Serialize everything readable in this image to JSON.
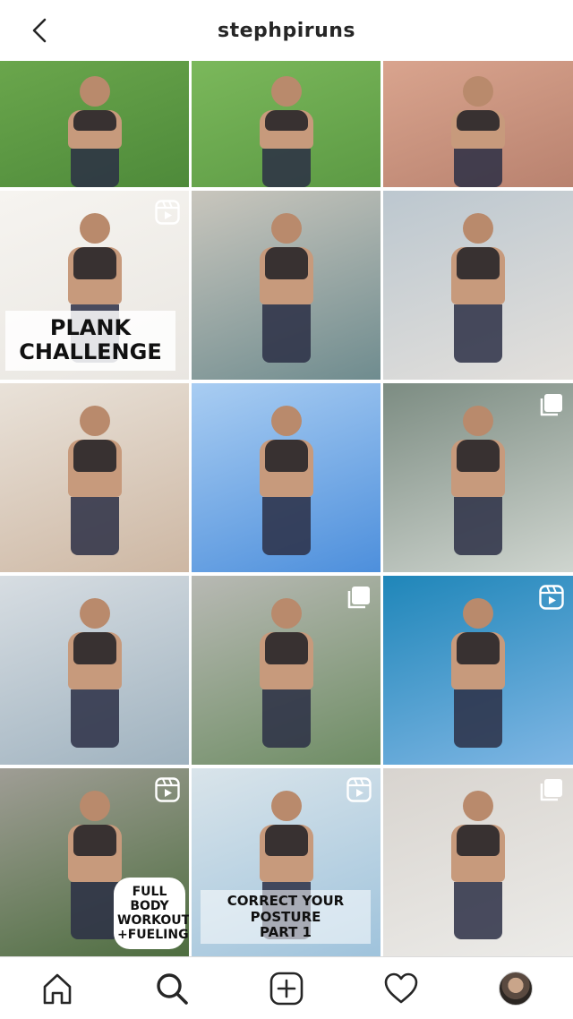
{
  "header": {
    "username": "stephpiruns"
  },
  "posts": [
    {
      "id": 1,
      "type": "photo",
      "overlay": "",
      "colors": [
        "#4e8a3a",
        "#6aa64c"
      ]
    },
    {
      "id": 2,
      "type": "photo",
      "overlay": "",
      "colors": [
        "#5c9a44",
        "#7bb85b"
      ]
    },
    {
      "id": 3,
      "type": "photo",
      "overlay": "",
      "colors": [
        "#b9826f",
        "#d9a48e"
      ]
    },
    {
      "id": 4,
      "type": "reel",
      "overlay": "PLANK CHALLENGE",
      "colors": [
        "#e9e6e1",
        "#f6f4f0"
      ]
    },
    {
      "id": 5,
      "type": "photo",
      "overlay": "",
      "colors": [
        "#6f8c8f",
        "#c9c6bd"
      ]
    },
    {
      "id": 6,
      "type": "photo",
      "overlay": "",
      "colors": [
        "#e3e0dc",
        "#bcc7cf"
      ]
    },
    {
      "id": 7,
      "type": "photo",
      "overlay": "",
      "colors": [
        "#cdb7a3",
        "#e9e2d9"
      ]
    },
    {
      "id": 8,
      "type": "photo",
      "overlay": "",
      "colors": [
        "#4d8fdc",
        "#a9cdf2"
      ]
    },
    {
      "id": 9,
      "type": "carousel",
      "overlay": "",
      "colors": [
        "#cfd5cf",
        "#7c8c82"
      ]
    },
    {
      "id": 10,
      "type": "photo",
      "overlay": "",
      "colors": [
        "#9fb2bf",
        "#d7dde2"
      ]
    },
    {
      "id": 11,
      "type": "carousel",
      "overlay": "",
      "colors": [
        "#6e8d64",
        "#b8b9b4"
      ]
    },
    {
      "id": 12,
      "type": "reel",
      "overlay": "",
      "colors": [
        "#7fb6e4",
        "#1f86b9"
      ]
    },
    {
      "id": 13,
      "type": "reel",
      "overlay": "FULL BODY\nWORKOUT\n+FUELING",
      "colors": [
        "#4d6d3f",
        "#9f9d95"
      ]
    },
    {
      "id": 14,
      "type": "reel",
      "overlay": "CORRECT YOUR POSTURE\nPART 1",
      "colors": [
        "#9fc3dc",
        "#d9e4ea"
      ]
    },
    {
      "id": 15,
      "type": "carousel",
      "overlay": "",
      "colors": [
        "#ecebe8",
        "#d8d4cf"
      ]
    }
  ],
  "icons": {
    "back": "chevron-left-icon",
    "reel": "reel-icon",
    "carousel": "carousel-icon",
    "home": "home-icon",
    "search": "search-icon",
    "add": "add-post-icon",
    "activity": "heart-icon",
    "profile": "avatar"
  }
}
